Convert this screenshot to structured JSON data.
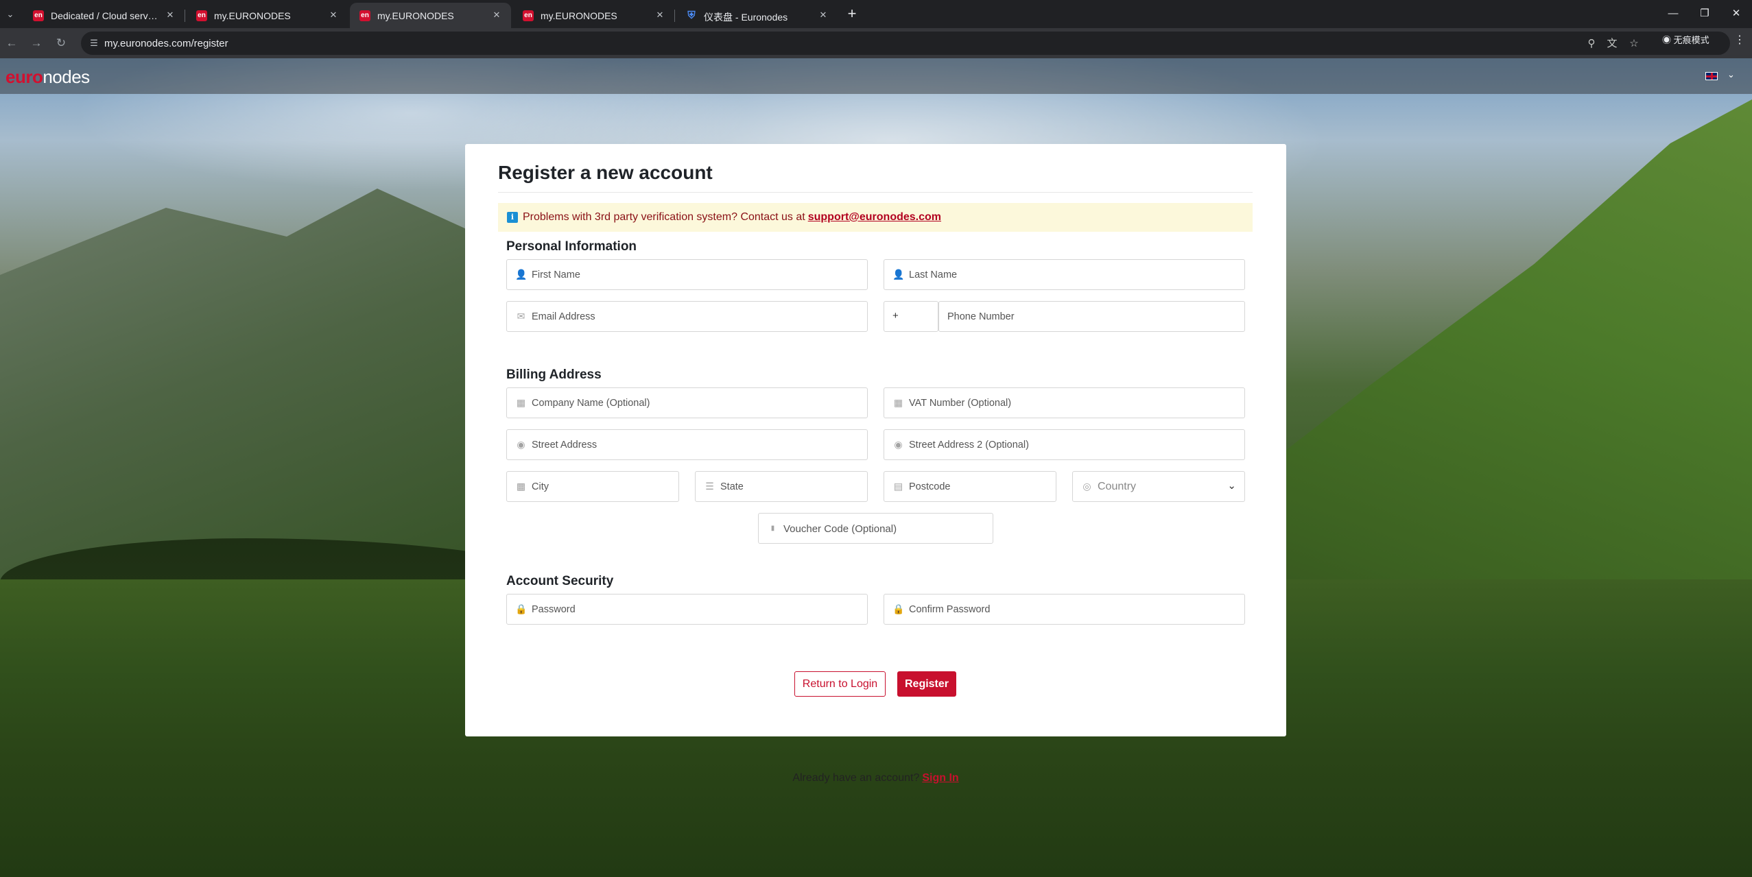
{
  "browser": {
    "tabs": [
      {
        "title": "Dedicated / Cloud servers P…",
        "favicon": "en"
      },
      {
        "title": "my.EURONODES",
        "favicon": "en"
      },
      {
        "title": "my.EURONODES",
        "favicon": "en"
      },
      {
        "title": "my.EURONODES",
        "favicon": "en"
      },
      {
        "title": "仪表盘 - Euronodes",
        "favicon": "shield"
      }
    ],
    "active_tab_index": 2,
    "url": "my.euronodes.com/register",
    "incognito_label": "无痕模式"
  },
  "site": {
    "logo_part1": "euro",
    "logo_part2": "nodes",
    "language": "en-GB",
    "accent_color": "#c8102e"
  },
  "form": {
    "title": "Register a new account",
    "alert": {
      "text": "Problems with 3rd party verification system? Contact us at",
      "email": "support@euronodes.com"
    },
    "personal": {
      "heading": "Personal Information",
      "first_name": "First Name",
      "last_name": "Last Name",
      "email": "Email Address",
      "phone_prefix": "+",
      "phone": "Phone Number"
    },
    "billing": {
      "heading": "Billing Address",
      "company": "Company Name (Optional)",
      "vat": "VAT Number (Optional)",
      "street": "Street Address",
      "street2": "Street Address 2 (Optional)",
      "city": "City",
      "state": "State",
      "postcode": "Postcode",
      "country": "Country",
      "voucher": "Voucher Code (Optional)"
    },
    "security": {
      "heading": "Account Security",
      "password": "Password",
      "confirm_password": "Confirm Password"
    },
    "buttons": {
      "return_login": "Return to Login",
      "register": "Register"
    },
    "footer": {
      "text": "Already have an account?",
      "link": "Sign In"
    }
  }
}
